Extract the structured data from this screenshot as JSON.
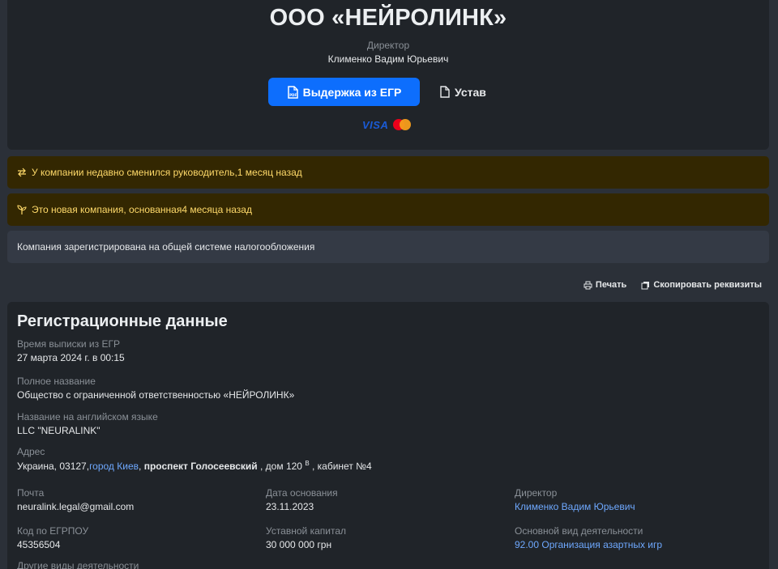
{
  "header": {
    "company_name": "ООО «НЕЙРОЛИНК»",
    "role_label": "Директор",
    "director_name": "Клименко Вадим Юрьевич",
    "btn_extract": "Выдержка из ЕГР",
    "btn_charter": "Устав",
    "payment_visa": "VISA"
  },
  "alerts": {
    "director_changed": "У компании недавно сменился руководитель,1 месяц назад",
    "new_company": "Это новая компания, основанная4 месяца назад",
    "tax_system": "Компания зарегистрирована на общей системе налогообложения"
  },
  "actions": {
    "print": "Печать",
    "copy": "Скопировать реквизиты"
  },
  "registration": {
    "title": "Регистрационные данные",
    "extract_time_label": "Время выписки из ЕГР",
    "extract_time_value": "27 марта 2024 г. в 00:15",
    "full_name_label": "Полное название",
    "full_name_value": "Общество с ограниченной ответственностью «НЕЙРОЛИНК»",
    "english_name_label": "Название на английском языке",
    "english_name_value": "LLC \"NEURALINK\"",
    "address_label": "Адрес",
    "address_prefix": "Украина, 03127,",
    "address_city": "город Киев",
    "address_sep": ",",
    "address_street": "проспект Голосеевский",
    "address_house": ", дом 120",
    "address_house_sup": "В",
    "address_office": ", кабинет №4",
    "email_label": "Почта",
    "email_value": "neuralink.legal@gmail.com",
    "founded_label": "Дата основания",
    "founded_value": "23.11.2023",
    "director_label": "Директор",
    "director_value": "Клименко Вадим Юрьевич",
    "edrpou_label": "Код по ЕГРПОУ",
    "edrpou_value": "45356504",
    "capital_label": "Уставной капитал",
    "capital_value": "30 000 000 грн",
    "activity_label": "Основной вид деятельности",
    "activity_value": "92.00 Организация азартных игр",
    "other_activities_label": "Другие виды деятельности"
  },
  "colors": {
    "page_bg": "#2b3038",
    "card_bg": "#202429",
    "primary": "#0d6efd",
    "warning_bg": "#332701",
    "warning_text": "#ffda6a",
    "link": "#6ea8fe"
  }
}
